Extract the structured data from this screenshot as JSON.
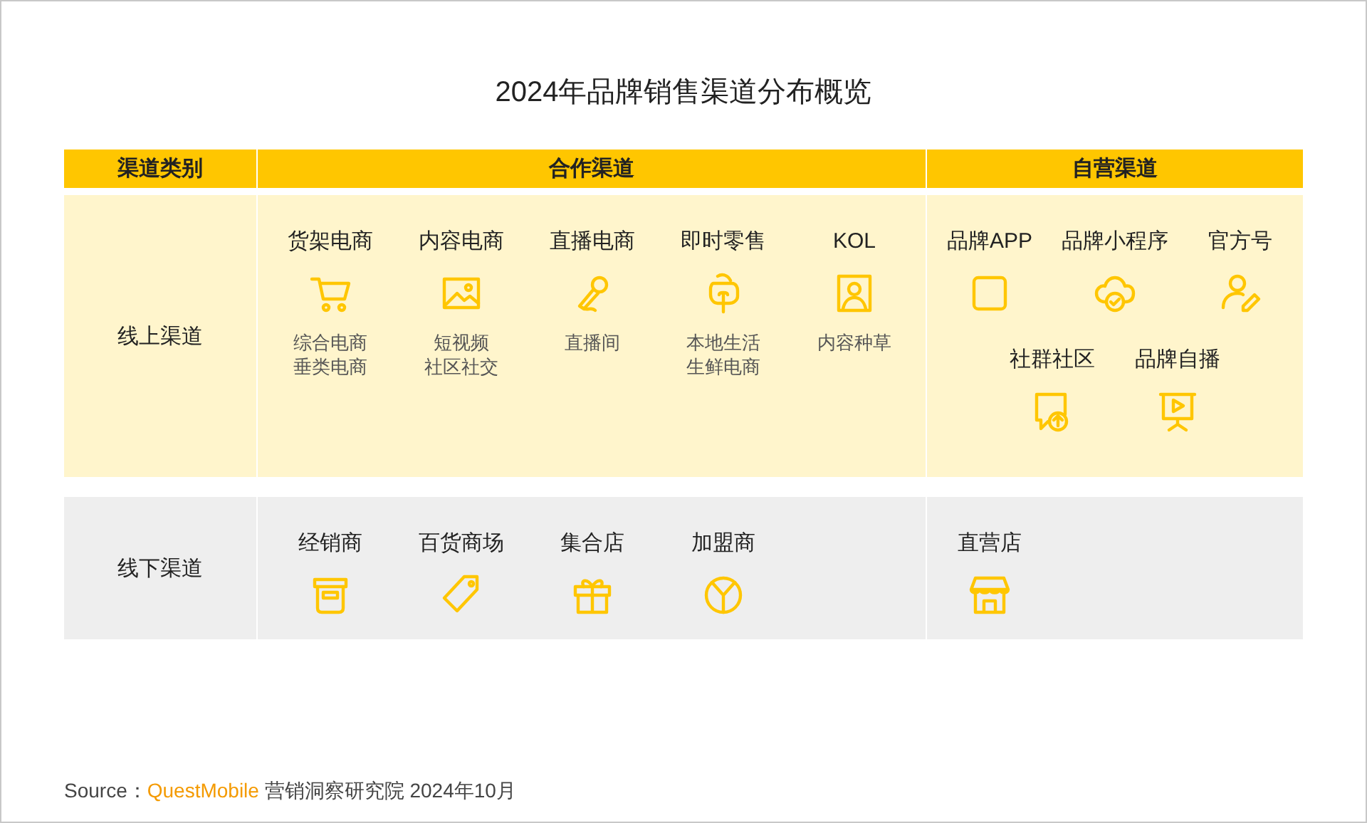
{
  "title": "2024年品牌销售渠道分布概览",
  "header": [
    {
      "label": "渠道类别"
    },
    {
      "label": "合作渠道"
    },
    {
      "label": "自营渠道"
    }
  ],
  "rows": [
    {
      "label": "线上渠道",
      "kind": "online",
      "partner": [
        {
          "name": "货架电商",
          "subs": [
            "综合电商",
            "垂类电商"
          ]
        },
        {
          "name": "内容电商",
          "subs": [
            "短视频",
            "社区社交"
          ]
        },
        {
          "name": "直播电商",
          "subs": [
            "直播间"
          ]
        },
        {
          "name": "即时零售",
          "subs": [
            "本地生活",
            "生鲜电商"
          ]
        },
        {
          "name": "KOL",
          "subs": [
            "内容种草"
          ]
        }
      ],
      "own": [
        {
          "name": "品牌APP"
        },
        {
          "name": "品牌小程序"
        },
        {
          "name": "官方号"
        },
        {
          "name": "社群社区"
        },
        {
          "name": "品牌自播"
        }
      ]
    },
    {
      "label": "线下渠道",
      "kind": "offline",
      "partner": [
        {
          "name": "经销商"
        },
        {
          "name": "百货商场"
        },
        {
          "name": "集合店"
        },
        {
          "name": "加盟商"
        }
      ],
      "own": [
        {
          "name": "直营店"
        }
      ]
    }
  ],
  "source": {
    "prefix": "Source：",
    "brand": "QuestMobile",
    "rest": "营销洞察研究院 2024年10月"
  }
}
